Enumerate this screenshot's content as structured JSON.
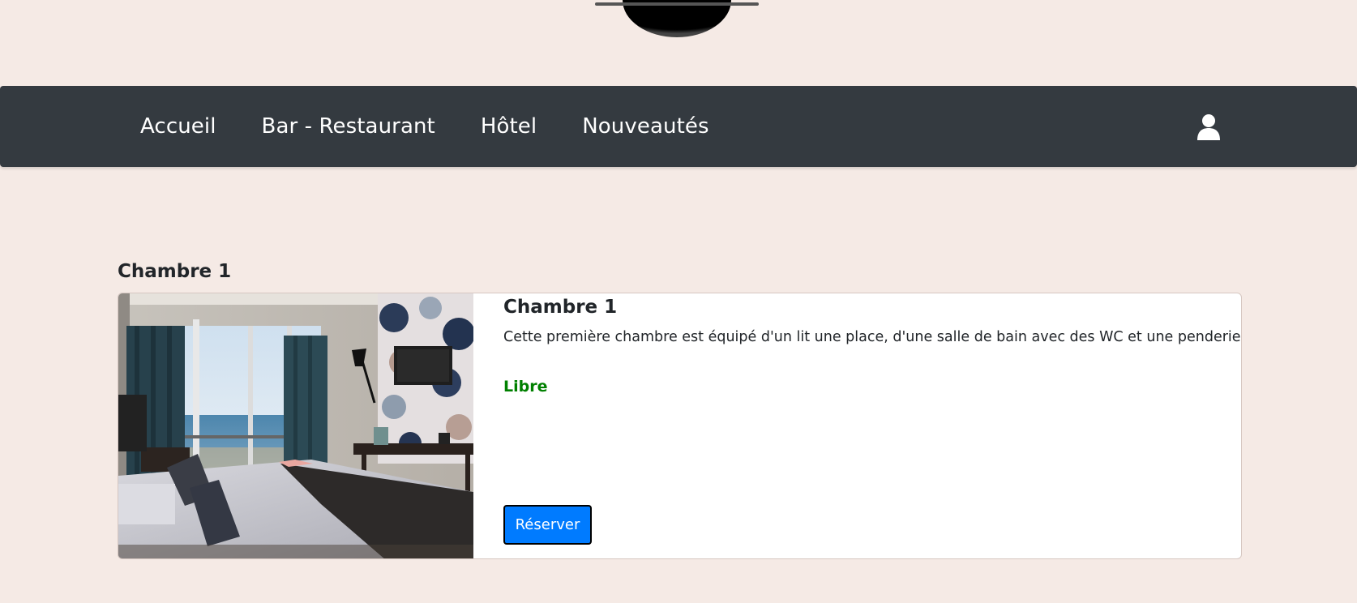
{
  "navbar": {
    "items": [
      {
        "label": "Accueil"
      },
      {
        "label": "Bar - Restaurant"
      },
      {
        "label": "Hôtel"
      },
      {
        "label": "Nouveautés"
      }
    ],
    "user_icon": "user-icon"
  },
  "section": {
    "title": "Chambre 1"
  },
  "card": {
    "title": "Chambre 1",
    "description": "Cette première chambre est équipé d'un lit une place, d'une salle de bain avec des WC et une penderie.",
    "status": "Libre",
    "reserve_label": "Réserver"
  },
  "colors": {
    "background": "#f5eae5",
    "navbar": "#343a40",
    "status_free": "#008000",
    "primary": "#007bff"
  }
}
